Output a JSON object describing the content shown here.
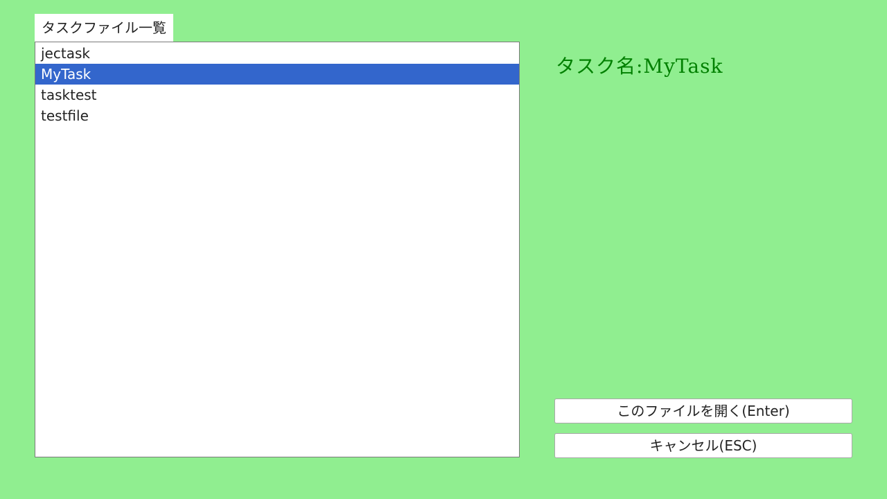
{
  "panel": {
    "title": "タスクファイル一覧"
  },
  "files": {
    "items": [
      {
        "label": "jectask",
        "selected": false
      },
      {
        "label": "MyTask",
        "selected": true
      },
      {
        "label": "tasktest",
        "selected": false
      },
      {
        "label": "testfile",
        "selected": false
      }
    ]
  },
  "detail": {
    "task_name": "タスク名:MyTask"
  },
  "buttons": {
    "open_label": "このファイルを開く(Enter)",
    "cancel_label": "キャンセル(ESC)"
  },
  "colors": {
    "background": "#90ee90",
    "selection": "#3366cc",
    "task_name_text": "#008000"
  }
}
